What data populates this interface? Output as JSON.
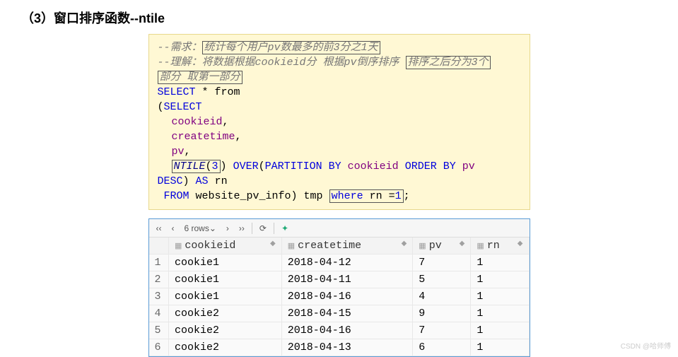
{
  "heading": "（3）窗口排序函数--ntile",
  "code": {
    "comment1_prefix": "--需求：",
    "comment1_boxed": "统计每个用户pv数最多的前3分之1天",
    "comment2_a": "--理解：将数据根据cookieid分  根据pv倒序排序",
    "comment2_box1": "排序之后分为3个",
    "comment2_box2": "部分 取第一部分",
    "select": "SELECT",
    "star_from": " * from",
    "lparen": "(",
    "select2": "SELECT",
    "col1": "cookieid",
    "col2": "createtime",
    "col3": "pv",
    "comma": ",",
    "ntile": "NTILE",
    "lparen2": "(",
    "three": "3",
    "rparen2": ")",
    "over": "OVER",
    "lparen3": "(",
    "partition": "PARTITION BY",
    "cookieid": "cookieid",
    "orderby": "ORDER BY",
    "pv": "pv",
    "desc": "DESC",
    "rparen3": ")",
    "as": "AS",
    "rn": " rn",
    "from": "FROM",
    "table": " website_pv_info) tmp",
    "where": "where",
    "rn_eq": " rn =",
    "one": "1",
    "semi": ";"
  },
  "toolbar": {
    "rows_label": "6 rows",
    "dropdown": "⌄"
  },
  "columns": [
    "cookieid",
    "createtime",
    "pv",
    "rn"
  ],
  "rows": [
    {
      "n": "1",
      "cookieid": "cookie1",
      "createtime": "2018-04-12",
      "pv": "7",
      "rn": "1"
    },
    {
      "n": "2",
      "cookieid": "cookie1",
      "createtime": "2018-04-11",
      "pv": "5",
      "rn": "1"
    },
    {
      "n": "3",
      "cookieid": "cookie1",
      "createtime": "2018-04-16",
      "pv": "4",
      "rn": "1"
    },
    {
      "n": "4",
      "cookieid": "cookie2",
      "createtime": "2018-04-15",
      "pv": "9",
      "rn": "1"
    },
    {
      "n": "5",
      "cookieid": "cookie2",
      "createtime": "2018-04-16",
      "pv": "7",
      "rn": "1"
    },
    {
      "n": "6",
      "cookieid": "cookie2",
      "createtime": "2018-04-13",
      "pv": "6",
      "rn": "1"
    }
  ],
  "watermark": "CSDN @哈师傅"
}
